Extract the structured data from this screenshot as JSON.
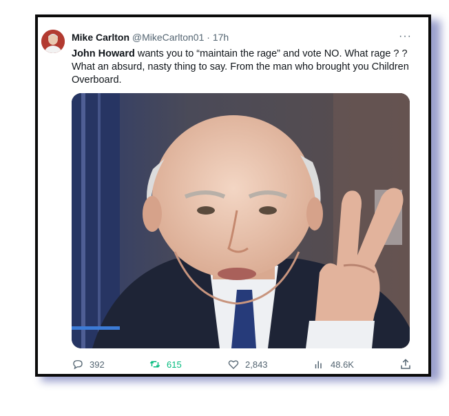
{
  "tweet": {
    "display_name": "Mike Carlton",
    "handle": "@MikeCarlton01",
    "separator": "·",
    "time": "17h",
    "more": "···",
    "mention": "John Howard",
    "text_rest": " wants you to “maintain the rage” and vote NO.  What rage ? ? What an absurd, nasty thing to say. From the man who brought you Children Overboard."
  },
  "actions": {
    "replies": "392",
    "retweets": "615",
    "likes": "2,843",
    "views": "48.6K"
  },
  "icons": {
    "reply": "reply-icon",
    "retweet": "retweet-icon",
    "like": "heart-icon",
    "views": "views-icon",
    "share": "share-icon",
    "more": "more-icon"
  },
  "colors": {
    "frame_border": "#0a0a0a",
    "frame_shadow": "#8f95c7",
    "retweet_accent": "#00ba7c",
    "muted_text": "#536471"
  }
}
